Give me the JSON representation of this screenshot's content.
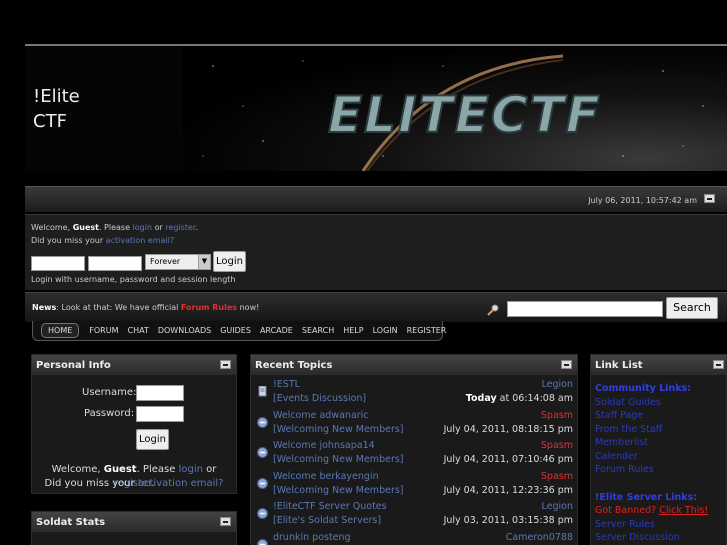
{
  "site": {
    "name_line1": "!Elite",
    "name_line2": "CTF",
    "banner_text": "ELITECTF"
  },
  "date_bar": {
    "datetime": "July 06, 2011, 10:57:42 am"
  },
  "login": {
    "welcome_prefix": "Welcome, ",
    "guest": "Guest",
    "please": ". Please ",
    "login_link": "login",
    "or": " or ",
    "register_link": "register",
    "period": ".",
    "missed_prefix": "Did you miss your ",
    "activation_link": "activation email?",
    "duration_value": "Forever",
    "login_button": "Login",
    "hint": "Login with username, password and session length"
  },
  "news": {
    "label": "News",
    "text": ": Look at that: We have official ",
    "link": "Forum Rules",
    "suffix": " now!"
  },
  "search": {
    "button": "Search",
    "placeholder": ""
  },
  "nav": {
    "items": [
      "HOME",
      "FORUM",
      "CHAT",
      "DOWNLOADS",
      "GUIDES",
      "ARCADE",
      "SEARCH",
      "HELP",
      "LOGIN",
      "REGISTER"
    ]
  },
  "personal_info": {
    "title": "Personal Info",
    "username_label": "Username:",
    "password_label": "Password:",
    "login_button": "Login",
    "welcome_prefix": "Welcome, ",
    "guest": "Guest",
    "please": ". Please ",
    "login_link": "login",
    "or": " or ",
    "register_link": "register",
    "period": ".",
    "missed_prefix": "Did you miss your ",
    "activation_link": "activation email?"
  },
  "soldat_stats": {
    "title": "Soldat Stats"
  },
  "recent_topics": {
    "title": "Recent Topics",
    "items": [
      {
        "subject": "!ESTL",
        "board": "[Events Discussion]",
        "author": "Legion",
        "author_color": "#5a78b4",
        "date_bold": "Today",
        "date": " at 06:14:08 am"
      },
      {
        "subject": "Welcome adwanaric",
        "board": "[Welcoming New Members]",
        "author": "Spasm",
        "author_color": "#e03030",
        "date_bold": "",
        "date": "July 04, 2011, 08:18:15 pm"
      },
      {
        "subject": "Welcome johnsapa14",
        "board": "[Welcoming New Members]",
        "author": "Spasm",
        "author_color": "#e03030",
        "date_bold": "",
        "date": "July 04, 2011, 07:10:46 pm"
      },
      {
        "subject": "Welcome berkayengin",
        "board": "[Welcoming New Members]",
        "author": "Spasm",
        "author_color": "#e03030",
        "date_bold": "",
        "date": "July 04, 2011, 12:23:36 pm"
      },
      {
        "subject": "!EliteCTF Server Quotes",
        "board": "[Elite's Soldat Servers]",
        "author": "Legion",
        "author_color": "#5a78b4",
        "date_bold": "",
        "date": "July 03, 2011, 03:15:38 pm"
      },
      {
        "subject": "drunkin posteng",
        "board": "",
        "author": "Cameron0788",
        "author_color": "#5a78b4",
        "date_bold": "",
        "date": ""
      }
    ]
  },
  "link_list": {
    "title": "Link List",
    "community_header": "Community Links:",
    "community": [
      "Soldat Guides",
      "Staff Page",
      "From the Staff",
      "Memberlist",
      "Calender",
      "Forum Rules"
    ],
    "server_header": "!Elite Server Links:",
    "got_banned": "Got Banned?",
    "click_this": "Click This!",
    "server": [
      "Server Rules",
      "Server Discussion"
    ]
  },
  "colors": {
    "link": "#5a78b4",
    "accent_red": "#e03030",
    "header_blue": "#2f3fe0"
  }
}
